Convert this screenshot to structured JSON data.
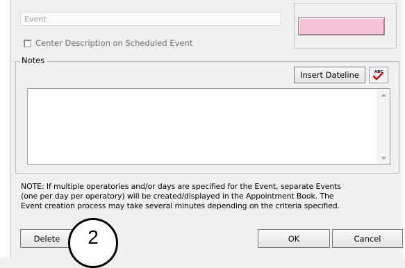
{
  "event_field": {
    "placeholder": "Event"
  },
  "color_swatch": {
    "color": "#f6c2d8"
  },
  "center_checkbox": {
    "label": "Center Description on Scheduled Event",
    "checked": false
  },
  "notes": {
    "legend": "Notes",
    "insert_dateline_label": "Insert Dateline",
    "spell_icon_text": "ABC",
    "value": ""
  },
  "note_message": {
    "lines": [
      "NOTE:  If multiple operatories and/or days are specified for the Event, separate Events",
      "(one per day per operatory) will be created/displayed in the Appointment Book.  The",
      "Event creation process may take several minutes depending on the criteria specified."
    ]
  },
  "buttons": {
    "delete": "Delete",
    "ok": "OK",
    "cancel": "Cancel"
  },
  "callout": {
    "number": "2"
  }
}
